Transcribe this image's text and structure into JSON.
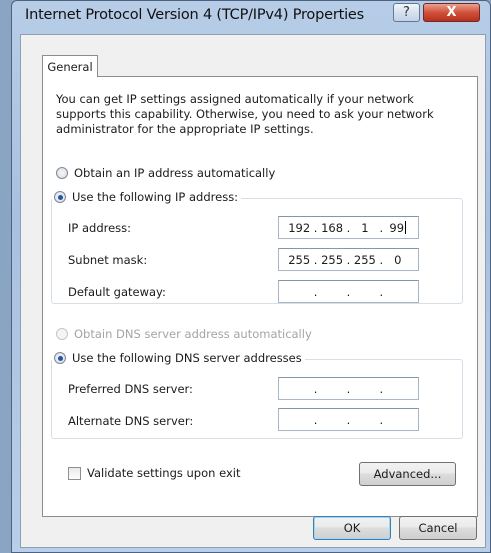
{
  "window": {
    "title": "Internet Protocol Version 4 (TCP/IPv4) Properties",
    "help_label": "?",
    "close_label": "X"
  },
  "tabs": [
    {
      "label": "General",
      "selected": true
    }
  ],
  "description": "You can get IP settings assigned automatically if your network supports this capability. Otherwise, you need to ask your network administrator for the appropriate IP settings.",
  "ip_section": {
    "auto_label": "Obtain an IP address automatically",
    "manual_label": "Use the following IP address:",
    "selected": "manual",
    "fields": [
      {
        "label": "IP address:",
        "octets": [
          "192",
          "168",
          "1",
          "99"
        ]
      },
      {
        "label": "Subnet mask:",
        "octets": [
          "255",
          "255",
          "255",
          "0"
        ]
      },
      {
        "label": "Default gateway:",
        "octets": [
          "",
          "",
          "",
          ""
        ]
      }
    ]
  },
  "dns_section": {
    "auto_label": "Obtain DNS server address automatically",
    "manual_label": "Use the following DNS server addresses",
    "selected": "manual",
    "auto_disabled": true,
    "fields": [
      {
        "label": "Preferred DNS server:",
        "octets": [
          "",
          "",
          "",
          ""
        ]
      },
      {
        "label": "Alternate DNS server:",
        "octets": [
          "",
          "",
          "",
          ""
        ]
      }
    ]
  },
  "validate": {
    "label": "Validate settings upon exit",
    "checked": false
  },
  "buttons": {
    "advanced": "Advanced...",
    "ok": "OK",
    "cancel": "Cancel"
  }
}
